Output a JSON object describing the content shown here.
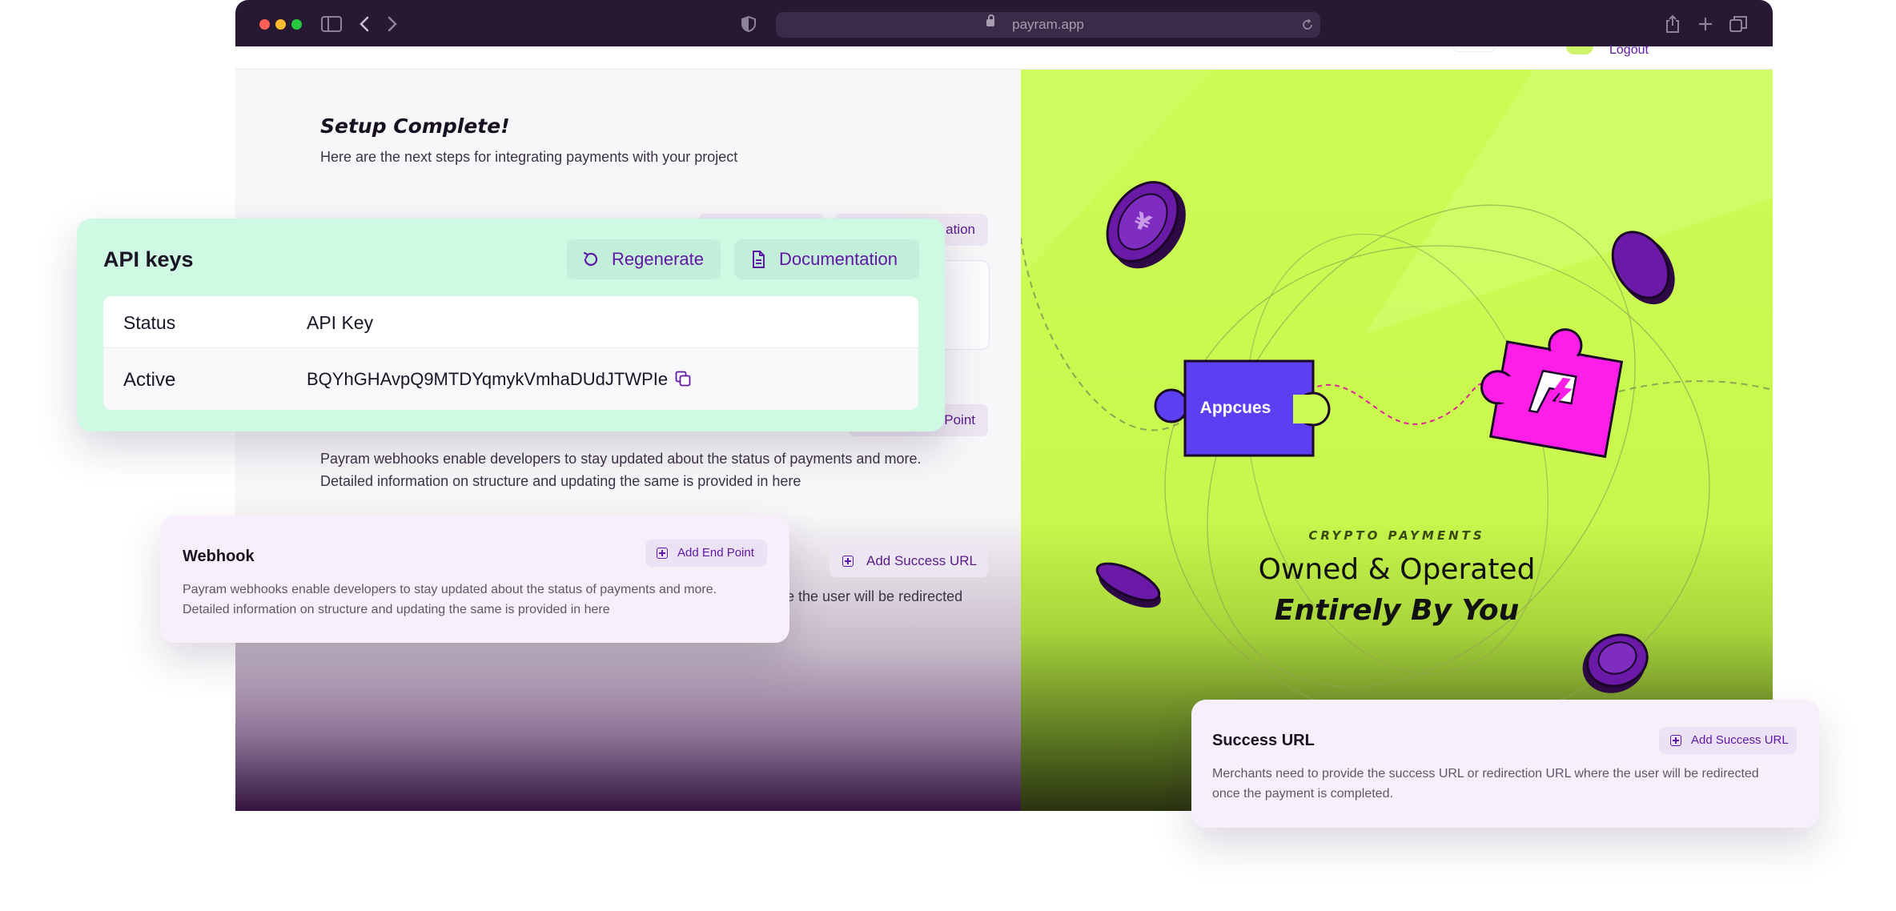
{
  "browser": {
    "url": "payram.app",
    "header_link": "Logout"
  },
  "setup": {
    "title": "Setup Complete!",
    "subtitle": "Here are the next steps for integrating payments with your project",
    "webhook_paragraph_line1": "Payram webhooks enable developers to stay updated about the status of payments and more.",
    "webhook_paragraph_line2": "Detailed information on structure and updating the same is provided in here",
    "behind_documentation": "ation",
    "behind_add_endpoint": "Point",
    "behind_add_success_url": "Add Success URL",
    "behind_redirect_fragment": "e the user will be redirected"
  },
  "promo": {
    "puzzle_label": "Appcues",
    "kicker": "CRYPTO PAYMENTS",
    "line1": "Owned & Operated",
    "line2": "Entirely By You",
    "colors": {
      "background": "#ccfb55",
      "coin": "#6a1aa6",
      "puzzle_left": "#5b3ff0",
      "puzzle_right": "#ff1ee8"
    }
  },
  "api_keys": {
    "title": "API keys",
    "regenerate_label": "Regenerate",
    "documentation_label": "Documentation",
    "columns": [
      "Status",
      "API Key"
    ],
    "rows": [
      {
        "status": "Active",
        "key": "BQYhGHAvpQ9MTDYqmykVmhaDUdJTWPIe"
      }
    ]
  },
  "webhook": {
    "title": "Webhook",
    "button_label": "Add End Point",
    "text_line1": "Payram webhooks enable developers to stay updated about the status of payments and more.",
    "text_line2": "Detailed information on structure and updating the same is provided in here"
  },
  "success_url": {
    "title": "Success URL",
    "button_label": "Add Success URL",
    "text_line1": "Merchants need to provide the success URL or redirection URL where the user will be redirected",
    "text_line2": "once the payment is completed."
  }
}
